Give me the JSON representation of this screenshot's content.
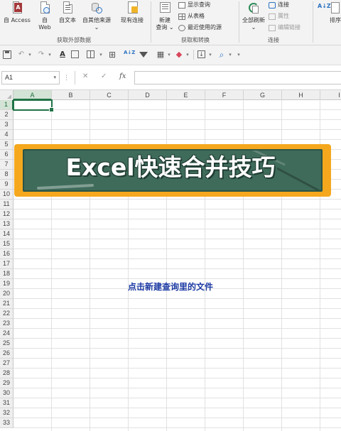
{
  "ribbon": {
    "get_external": {
      "access_label": "自 Access",
      "web_label_1": "自",
      "web_label_2": "Web",
      "text_label": "自文本",
      "other_label": "自其他来源",
      "other_caret": "⌄",
      "group_label": "获取外部数据"
    },
    "existing_label": "现有连接",
    "get_transform": {
      "new_query_1": "新建",
      "new_query_2": "查询",
      "new_query_caret": "⌄",
      "show_queries": "显示查询",
      "from_table": "从表格",
      "recent_sources": "最近使用的源",
      "group_label": "获取和转换"
    },
    "connections": {
      "refresh_all": "全部刷新",
      "refresh_caret": "⌄",
      "connections": "连接",
      "properties": "属性",
      "edit_links": "编辑链接",
      "group_label": "连接"
    },
    "sort": {
      "sort_az": "A↓Z",
      "sort_label": "排序"
    }
  },
  "qat": {
    "undo": "↶",
    "redo": "↷",
    "font_color": "A",
    "sort_icon": "A↓Z",
    "search": "⌕",
    "customize": "▾"
  },
  "formula_bar": {
    "name_box": "A1",
    "name_caret": "▾",
    "dots": "⋮",
    "cancel": "✕",
    "enter": "✓",
    "fx": "fx",
    "value": ""
  },
  "sheet": {
    "columns": [
      "A",
      "B",
      "C",
      "D",
      "E",
      "F",
      "G",
      "H",
      "I"
    ],
    "rows": [
      "1",
      "2",
      "3",
      "4",
      "5",
      "6",
      "7",
      "8",
      "9",
      "10",
      "11",
      "12",
      "13",
      "14",
      "15",
      "16",
      "17",
      "18",
      "19",
      "20",
      "21",
      "22",
      "23",
      "24",
      "25",
      "26",
      "27",
      "28",
      "29",
      "30",
      "31",
      "32",
      "33"
    ],
    "active_cell": "A1"
  },
  "overlay": {
    "title": "Excel快速合并技巧",
    "caption": "点击新建查询里的文件"
  },
  "colors": {
    "excel_green": "#217346",
    "banner_orange": "#f5a81e",
    "board_green": "#3f6b5a",
    "caption_blue": "#1c3aa3"
  }
}
